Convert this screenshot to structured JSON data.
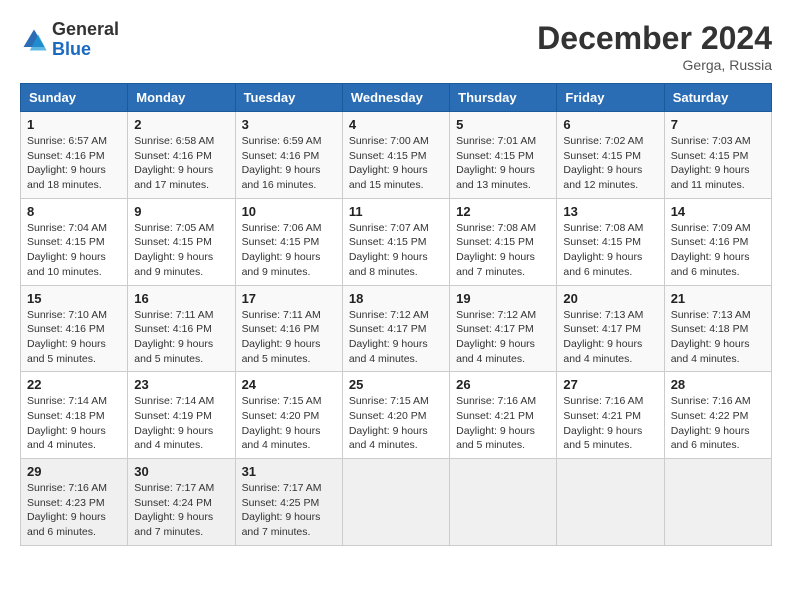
{
  "header": {
    "logo_general": "General",
    "logo_blue": "Blue",
    "month_title": "December 2024",
    "location": "Gerga, Russia"
  },
  "weekdays": [
    "Sunday",
    "Monday",
    "Tuesday",
    "Wednesday",
    "Thursday",
    "Friday",
    "Saturday"
  ],
  "weeks": [
    [
      {
        "day": "1",
        "sunrise": "6:57 AM",
        "sunset": "4:16 PM",
        "daylight": "9 hours and 18 minutes."
      },
      {
        "day": "2",
        "sunrise": "6:58 AM",
        "sunset": "4:16 PM",
        "daylight": "9 hours and 17 minutes."
      },
      {
        "day": "3",
        "sunrise": "6:59 AM",
        "sunset": "4:16 PM",
        "daylight": "9 hours and 16 minutes."
      },
      {
        "day": "4",
        "sunrise": "7:00 AM",
        "sunset": "4:15 PM",
        "daylight": "9 hours and 15 minutes."
      },
      {
        "day": "5",
        "sunrise": "7:01 AM",
        "sunset": "4:15 PM",
        "daylight": "9 hours and 13 minutes."
      },
      {
        "day": "6",
        "sunrise": "7:02 AM",
        "sunset": "4:15 PM",
        "daylight": "9 hours and 12 minutes."
      },
      {
        "day": "7",
        "sunrise": "7:03 AM",
        "sunset": "4:15 PM",
        "daylight": "9 hours and 11 minutes."
      }
    ],
    [
      {
        "day": "8",
        "sunrise": "7:04 AM",
        "sunset": "4:15 PM",
        "daylight": "9 hours and 10 minutes."
      },
      {
        "day": "9",
        "sunrise": "7:05 AM",
        "sunset": "4:15 PM",
        "daylight": "9 hours and 9 minutes."
      },
      {
        "day": "10",
        "sunrise": "7:06 AM",
        "sunset": "4:15 PM",
        "daylight": "9 hours and 9 minutes."
      },
      {
        "day": "11",
        "sunrise": "7:07 AM",
        "sunset": "4:15 PM",
        "daylight": "9 hours and 8 minutes."
      },
      {
        "day": "12",
        "sunrise": "7:08 AM",
        "sunset": "4:15 PM",
        "daylight": "9 hours and 7 minutes."
      },
      {
        "day": "13",
        "sunrise": "7:08 AM",
        "sunset": "4:15 PM",
        "daylight": "9 hours and 6 minutes."
      },
      {
        "day": "14",
        "sunrise": "7:09 AM",
        "sunset": "4:16 PM",
        "daylight": "9 hours and 6 minutes."
      }
    ],
    [
      {
        "day": "15",
        "sunrise": "7:10 AM",
        "sunset": "4:16 PM",
        "daylight": "9 hours and 5 minutes."
      },
      {
        "day": "16",
        "sunrise": "7:11 AM",
        "sunset": "4:16 PM",
        "daylight": "9 hours and 5 minutes."
      },
      {
        "day": "17",
        "sunrise": "7:11 AM",
        "sunset": "4:16 PM",
        "daylight": "9 hours and 5 minutes."
      },
      {
        "day": "18",
        "sunrise": "7:12 AM",
        "sunset": "4:17 PM",
        "daylight": "9 hours and 4 minutes."
      },
      {
        "day": "19",
        "sunrise": "7:12 AM",
        "sunset": "4:17 PM",
        "daylight": "9 hours and 4 minutes."
      },
      {
        "day": "20",
        "sunrise": "7:13 AM",
        "sunset": "4:17 PM",
        "daylight": "9 hours and 4 minutes."
      },
      {
        "day": "21",
        "sunrise": "7:13 AM",
        "sunset": "4:18 PM",
        "daylight": "9 hours and 4 minutes."
      }
    ],
    [
      {
        "day": "22",
        "sunrise": "7:14 AM",
        "sunset": "4:18 PM",
        "daylight": "9 hours and 4 minutes."
      },
      {
        "day": "23",
        "sunrise": "7:14 AM",
        "sunset": "4:19 PM",
        "daylight": "9 hours and 4 minutes."
      },
      {
        "day": "24",
        "sunrise": "7:15 AM",
        "sunset": "4:20 PM",
        "daylight": "9 hours and 4 minutes."
      },
      {
        "day": "25",
        "sunrise": "7:15 AM",
        "sunset": "4:20 PM",
        "daylight": "9 hours and 4 minutes."
      },
      {
        "day": "26",
        "sunrise": "7:16 AM",
        "sunset": "4:21 PM",
        "daylight": "9 hours and 5 minutes."
      },
      {
        "day": "27",
        "sunrise": "7:16 AM",
        "sunset": "4:21 PM",
        "daylight": "9 hours and 5 minutes."
      },
      {
        "day": "28",
        "sunrise": "7:16 AM",
        "sunset": "4:22 PM",
        "daylight": "9 hours and 6 minutes."
      }
    ],
    [
      {
        "day": "29",
        "sunrise": "7:16 AM",
        "sunset": "4:23 PM",
        "daylight": "9 hours and 6 minutes."
      },
      {
        "day": "30",
        "sunrise": "7:17 AM",
        "sunset": "4:24 PM",
        "daylight": "9 hours and 7 minutes."
      },
      {
        "day": "31",
        "sunrise": "7:17 AM",
        "sunset": "4:25 PM",
        "daylight": "9 hours and 7 minutes."
      },
      null,
      null,
      null,
      null
    ]
  ]
}
